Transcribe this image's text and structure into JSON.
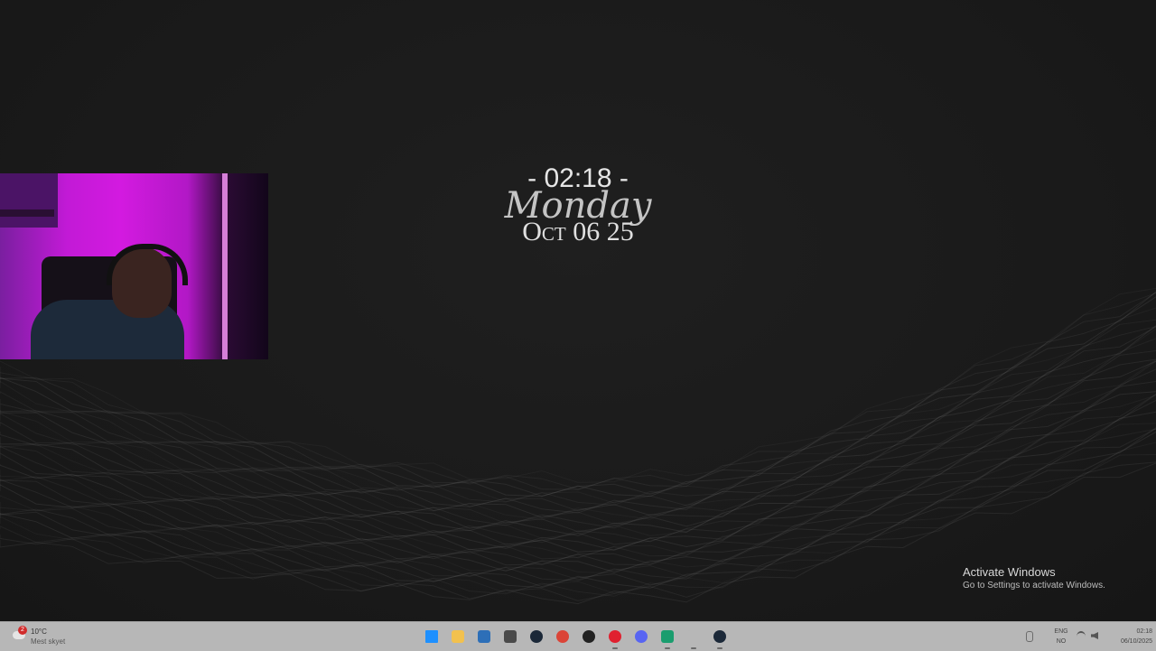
{
  "desktop": {
    "clock_widget": {
      "time": "- 02:18 -",
      "day": "Monday",
      "date": "Oct 06 25"
    },
    "activation": {
      "title": "Activate Windows",
      "subtitle": "Go to Settings to activate Windows."
    }
  },
  "taskbar": {
    "weather": {
      "badge": "2",
      "temperature": "10°C",
      "description": "Mest skyet",
      "icon": "cloud-icon"
    },
    "apps": [
      {
        "name": "start",
        "icon": "windows-logo-icon",
        "color": "#1e90ff",
        "running": false
      },
      {
        "name": "file-explorer",
        "icon": "folder-icon",
        "color": "#f2c14e",
        "running": false
      },
      {
        "name": "microsoft-store",
        "icon": "store-icon",
        "color": "#2d6fb8",
        "running": false
      },
      {
        "name": "cube-app",
        "icon": "cube-icon",
        "color": "#4a4a4a",
        "running": false
      },
      {
        "name": "steam",
        "icon": "steam-icon",
        "color": "#1b2838",
        "running": false
      },
      {
        "name": "chrome",
        "icon": "chrome-icon",
        "color": "#db4437",
        "running": false
      },
      {
        "name": "g-app",
        "icon": "g-logo-icon",
        "color": "#222222",
        "running": false
      },
      {
        "name": "opera",
        "icon": "opera-icon",
        "color": "#e0202f",
        "running": true
      },
      {
        "name": "discord",
        "icon": "discord-icon",
        "color": "#5865f2",
        "running": false
      },
      {
        "name": "green-app",
        "icon": "robot-icon",
        "color": "#1a9d6e",
        "running": true
      },
      {
        "name": "blank-app",
        "icon": "blank-icon",
        "color": "#b7b7b7",
        "running": true
      },
      {
        "name": "steam-2",
        "icon": "steam-icon",
        "color": "#1b2838",
        "running": true
      }
    ],
    "tray": {
      "language_line1": "ENG",
      "language_line2": "NO",
      "time": "02:18",
      "date": "06/10/2025"
    }
  }
}
